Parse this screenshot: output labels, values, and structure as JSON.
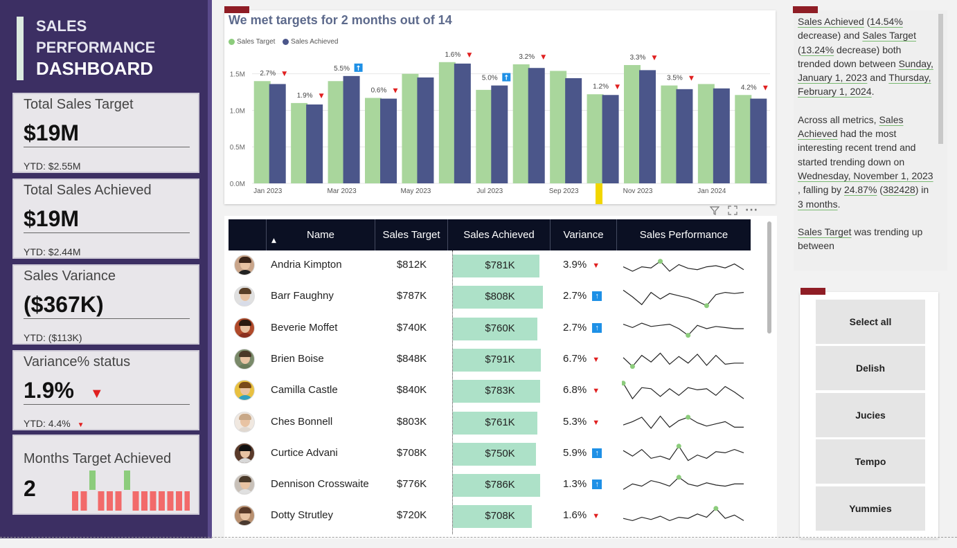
{
  "sidebar": {
    "title_line1": "SALES",
    "title_line2": "PERFORMANCE",
    "title_line3": "DASHBOARD"
  },
  "kpis": {
    "total_sales_target": {
      "label": "Total Sales Target",
      "value": "$19M",
      "ytd_label": "YTD:",
      "ytd_value": "$2.55M"
    },
    "total_sales_achieved": {
      "label": "Total Sales Achieved",
      "value": "$19M",
      "ytd_label": "YTD:",
      "ytd_value": "$2.44M"
    },
    "sales_variance": {
      "label": "Sales Variance",
      "value": "($367K)",
      "ytd_label": "YTD:",
      "ytd_value": "($113K)"
    },
    "variance_status": {
      "label": "Variance% status",
      "value": "1.9%",
      "ytd_label": "YTD:",
      "ytd_value": "4.4%"
    },
    "months_target": {
      "label": "Months Target Achieved",
      "value": "2",
      "month_flags": [
        0,
        0,
        1,
        0,
        0,
        0,
        1,
        0,
        0,
        0,
        0,
        0,
        0,
        0
      ]
    }
  },
  "colors": {
    "target": "#a9d69c",
    "achieved": "#4b568a",
    "hit": "#8ccc7c",
    "miss": "#f26a6a",
    "down_arrow": "#e02020",
    "up_badge": "#1e90e6"
  },
  "chart_data": {
    "type": "bar",
    "title": "We met targets for 2 months out of 14",
    "series": [
      {
        "name": "Sales Target",
        "values": [
          1.4,
          1.1,
          1.4,
          1.17,
          1.5,
          1.66,
          1.28,
          1.63,
          1.54,
          1.22,
          1.62,
          1.34,
          1.36,
          1.21
        ]
      },
      {
        "name": "Sales Achieved",
        "values": [
          1.36,
          1.08,
          1.47,
          1.16,
          1.45,
          1.64,
          1.34,
          1.58,
          1.44,
          1.21,
          1.55,
          1.29,
          1.3,
          1.16
        ]
      }
    ],
    "variance_labels": [
      "2.7%",
      "1.9%",
      "5.5%",
      "0.6%",
      "",
      "1.6%",
      "5.0%",
      "3.2%",
      "",
      "1.2%",
      "3.3%",
      "3.5%",
      "",
      "4.2%"
    ],
    "variance_dir": [
      "down",
      "down",
      "up",
      "down",
      "",
      "down",
      "up",
      "down",
      "",
      "down",
      "down",
      "down",
      "",
      "down"
    ],
    "x_tick_labels": [
      "Jan 2023",
      "",
      "Mar 2023",
      "",
      "May 2023",
      "",
      "Jul 2023",
      "",
      "Sep 2023",
      "",
      "Nov 2023",
      "",
      "Jan 2024",
      ""
    ],
    "y_ticks": [
      "0.0M",
      "0.5M",
      "1.0M",
      "1.5M"
    ],
    "ylim": [
      0,
      1.8
    ],
    "grid": true,
    "legend_position": "top-left"
  },
  "table": {
    "columns": [
      "Name",
      "Sales Target",
      "Sales Achieved",
      "Variance",
      "Sales Performance"
    ],
    "rows": [
      {
        "name": "Andria Kimpton",
        "target": "$812K",
        "achieved": "$781K",
        "achieved_value": 781,
        "variance": "3.9%",
        "dir": "down",
        "avatar": {
          "hair": "#3a2418",
          "shirt": "#222",
          "bg": "#c9a58a"
        },
        "spark": [
          0.55,
          0.75,
          0.55,
          0.6,
          0.3,
          0.75,
          0.45,
          0.62,
          0.68,
          0.55,
          0.5,
          0.6,
          0.42,
          0.68
        ],
        "spark_peak": 4
      },
      {
        "name": "Barr Faughny",
        "target": "$787K",
        "achieved": "$808K",
        "achieved_value": 808,
        "variance": "2.7%",
        "dir": "up",
        "avatar": {
          "hair": "#5a4028",
          "shirt": "#d8dce8",
          "bg": "#e0e0e0"
        },
        "spark": [
          0.2,
          0.5,
          0.85,
          0.3,
          0.6,
          0.35,
          0.45,
          0.55,
          0.7,
          0.9,
          0.4,
          0.3,
          0.35,
          0.3
        ],
        "spark_peak": 9
      },
      {
        "name": "Beverie Moffet",
        "target": "$740K",
        "achieved": "$760K",
        "achieved_value": 760,
        "variance": "2.7%",
        "dir": "up",
        "avatar": {
          "hair": "#2a1a10",
          "shirt": "#8a3020",
          "bg": "#b04a2a"
        },
        "spark": [
          0.3,
          0.45,
          0.25,
          0.4,
          0.35,
          0.3,
          0.5,
          0.8,
          0.35,
          0.5,
          0.4,
          0.45,
          0.5,
          0.5
        ],
        "spark_peak": 7
      },
      {
        "name": "Brien Boise",
        "target": "$848K",
        "achieved": "$791K",
        "achieved_value": 791,
        "variance": "6.7%",
        "dir": "down",
        "avatar": {
          "hair": "#4a3828",
          "shirt": "#6a7a5a",
          "bg": "#7a8a6a"
        },
        "spark": [
          0.4,
          0.8,
          0.3,
          0.6,
          0.2,
          0.7,
          0.35,
          0.65,
          0.25,
          0.75,
          0.3,
          0.7,
          0.65,
          0.65
        ],
        "spark_peak": 1
      },
      {
        "name": "Camilla Castle",
        "target": "$840K",
        "achieved": "$783K",
        "achieved_value": 783,
        "variance": "6.8%",
        "dir": "down",
        "avatar": {
          "hair": "#7a4a1a",
          "shirt": "#30a0c0",
          "bg": "#e8c040"
        },
        "spark": [
          0.15,
          0.85,
          0.35,
          0.4,
          0.75,
          0.4,
          0.7,
          0.35,
          0.45,
          0.4,
          0.7,
          0.3,
          0.55,
          0.85
        ],
        "spark_peak": 0
      },
      {
        "name": "Ches Bonnell",
        "target": "$803K",
        "achieved": "$761K",
        "achieved_value": 761,
        "variance": "5.3%",
        "dir": "down",
        "avatar": {
          "hair": "#c8a888",
          "shirt": "#e0d8d0",
          "bg": "#f0e8e0"
        },
        "spark": [
          0.6,
          0.45,
          0.25,
          0.75,
          0.2,
          0.7,
          0.4,
          0.25,
          0.5,
          0.65,
          0.55,
          0.45,
          0.7,
          0.7
        ],
        "spark_peak": 7
      },
      {
        "name": "Curtice Advani",
        "target": "$708K",
        "achieved": "$750K",
        "achieved_value": 750,
        "variance": "5.9%",
        "dir": "up",
        "avatar": {
          "hair": "#111",
          "shirt": "#d8d8d8",
          "bg": "#5a3a2a"
        },
        "spark": [
          0.35,
          0.6,
          0.3,
          0.7,
          0.6,
          0.75,
          0.15,
          0.8,
          0.55,
          0.7,
          0.4,
          0.45,
          0.3,
          0.45
        ],
        "spark_peak": 6
      },
      {
        "name": "Dennison Crosswaite",
        "target": "$776K",
        "achieved": "$786K",
        "achieved_value": 786,
        "variance": "1.3%",
        "dir": "up",
        "avatar": {
          "hair": "#4a3a2a",
          "shirt": "#e0e0e0",
          "bg": "#c8c0b8"
        },
        "spark": [
          0.7,
          0.45,
          0.55,
          0.3,
          0.4,
          0.55,
          0.15,
          0.45,
          0.55,
          0.4,
          0.5,
          0.55,
          0.45,
          0.45
        ],
        "spark_peak": 6
      },
      {
        "name": "Dotty Strutley",
        "target": "$720K",
        "achieved": "$708K",
        "achieved_value": 708,
        "variance": "1.6%",
        "dir": "down",
        "avatar": {
          "hair": "#5a3a28",
          "shirt": "#4a3a30",
          "bg": "#b89070"
        },
        "spark": [
          0.6,
          0.7,
          0.55,
          0.65,
          0.5,
          0.7,
          0.55,
          0.6,
          0.4,
          0.55,
          0.15,
          0.6,
          0.45,
          0.7
        ],
        "spark_peak": 10
      }
    ]
  },
  "narrative": {
    "p1_a": "Sales Achieved",
    "p1_b": " (",
    "p1_c": "14.54%",
    "p1_d": " decrease) and ",
    "p1_e": "Sales Target",
    "p1_f": " (",
    "p1_g": "13.24%",
    "p1_h": " decrease) both trended down between ",
    "p1_i": "Sunday, January 1, 2023",
    "p1_j": " and ",
    "p1_k": "Thursday, February 1, 2024",
    "p1_l": ".",
    "p2_a": "Across all metrics, ",
    "p2_b": "Sales Achieved",
    "p2_c": " had the most interesting recent trend and started trending down on ",
    "p2_d": "Wednesday, November 1, 2023",
    "p2_e": ", falling by ",
    "p2_f": "24.87%",
    "p2_g": " (",
    "p2_h": "382428",
    "p2_i": ") in ",
    "p2_j": "3 months",
    "p2_k": ".",
    "p3_a": "Sales Target",
    "p3_b": " was trending up between"
  },
  "slicer": {
    "options": [
      "Select all",
      "Delish",
      "Jucies",
      "Tempo",
      "Yummies"
    ]
  },
  "panel_icons": {
    "filter": "filter-icon",
    "focus": "focus-mode-icon",
    "more": "more-options-icon"
  }
}
